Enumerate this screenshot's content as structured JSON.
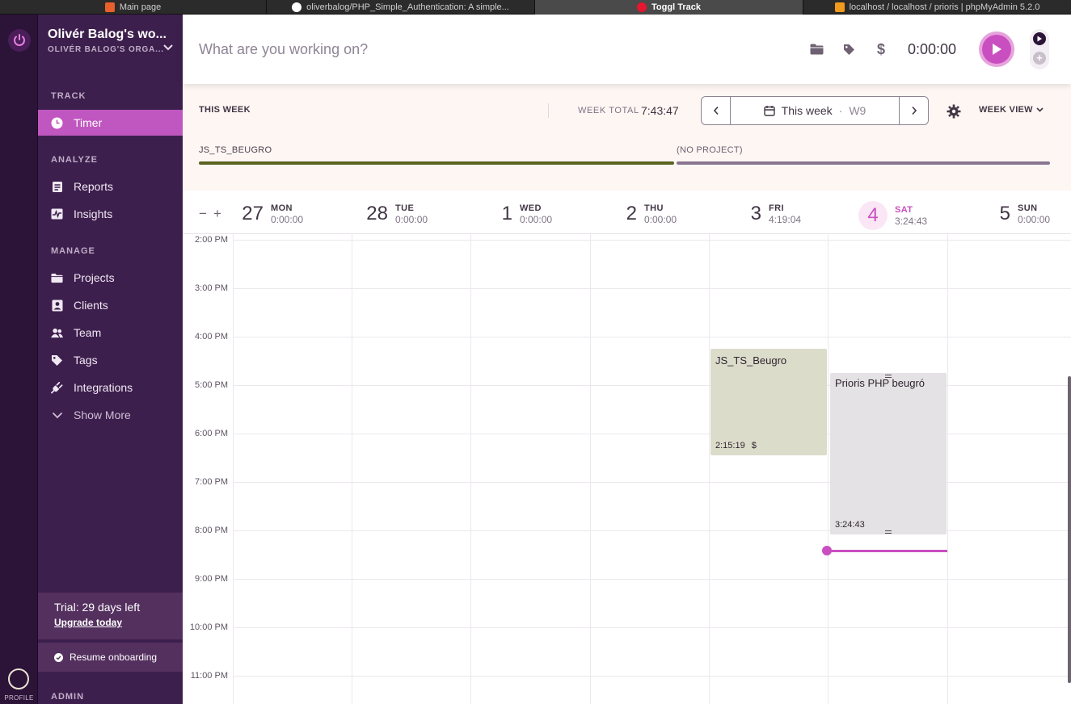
{
  "browser_tabs": [
    {
      "title": "Main page",
      "color": "#e8602b"
    },
    {
      "title": "oliverbalog/PHP_Simple_Authentication: A simple...",
      "color": "#ffffff"
    },
    {
      "title": "Toggl Track",
      "color": "#e5162f"
    },
    {
      "title": "localhost / localhost / prioris | phpMyAdmin 5.2.0",
      "color": "#f29a1b"
    }
  ],
  "workspace": {
    "name": "Olivér Balog's wo...",
    "org": "OLIVÉR BALOG'S ORGA..."
  },
  "sidebar": {
    "track_label": "TRACK",
    "timer_label": "Timer",
    "analyze_label": "ANALYZE",
    "reports_label": "Reports",
    "insights_label": "Insights",
    "manage_label": "MANAGE",
    "projects_label": "Projects",
    "clients_label": "Clients",
    "team_label": "Team",
    "tags_label": "Tags",
    "integrations_label": "Integrations",
    "show_more_label": "Show More",
    "trial_text": "Trial: 29 days left",
    "upgrade_link": "Upgrade today",
    "onboarding_label": "Resume onboarding",
    "admin_label": "ADMIN",
    "profile_label": "PROFILE"
  },
  "timer": {
    "placeholder": "What are you working on?",
    "duration": "0:00:00"
  },
  "summary": {
    "this_week": "THIS WEEK",
    "week_total_label": "WEEK TOTAL",
    "week_total": "7:43:47",
    "week_label": "This week",
    "week_sep": "·",
    "week_number": "W9",
    "week_view": "WEEK VIEW",
    "projects": [
      {
        "name": "JS_TS_BEUGRO",
        "color": "#5b631f"
      },
      {
        "name": "(NO PROJECT)",
        "color": "#8a7591"
      }
    ]
  },
  "days": [
    {
      "num": "27",
      "name": "MON",
      "total": "0:00:00"
    },
    {
      "num": "28",
      "name": "TUE",
      "total": "0:00:00"
    },
    {
      "num": "1",
      "name": "WED",
      "total": "0:00:00"
    },
    {
      "num": "2",
      "name": "THU",
      "total": "0:00:00"
    },
    {
      "num": "3",
      "name": "FRI",
      "total": "4:19:04"
    },
    {
      "num": "4",
      "name": "SAT",
      "total": "3:24:43"
    },
    {
      "num": "5",
      "name": "SUN",
      "total": "0:00:00"
    }
  ],
  "zoom": {
    "minus": "−",
    "plus": "+"
  },
  "hours": [
    "2:00 PM",
    "3:00 PM",
    "4:00 PM",
    "5:00 PM",
    "6:00 PM",
    "7:00 PM",
    "8:00 PM",
    "9:00 PM",
    "10:00 PM",
    "11:00 PM"
  ],
  "entries": [
    {
      "description": "JS_TS_Beugro",
      "duration": "2:15:19",
      "billable": "$",
      "color": "#dcdccb"
    },
    {
      "description": "Prioris PHP beugró",
      "duration": "3:24:43",
      "color": "#e4e2e4"
    }
  ],
  "colors": {
    "accent": "#c94fc0",
    "sidebar": "#3d1f4d",
    "rail": "#2c1338"
  }
}
